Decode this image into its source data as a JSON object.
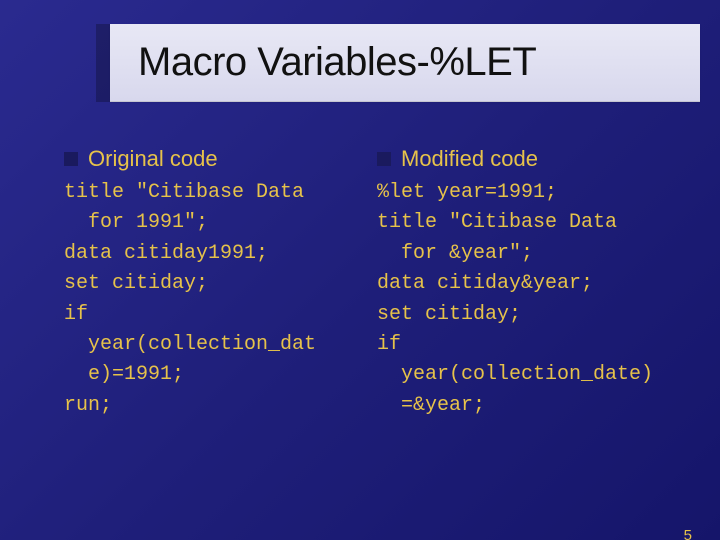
{
  "title": "Macro Variables-%LET",
  "left": {
    "heading": "Original code",
    "code": "title \"Citibase Data\n  for 1991\";\ndata citiday1991;\nset citiday;\nif\n  year(collection_dat\n  e)=1991;\nrun;"
  },
  "right": {
    "heading": "Modified code",
    "code": "%let year=1991;\ntitle \"Citibase Data\n  for &year\";\ndata citiday&year;\nset citiday;\nif\n  year(collection_date)\n  =&year;"
  },
  "page_number": "5"
}
